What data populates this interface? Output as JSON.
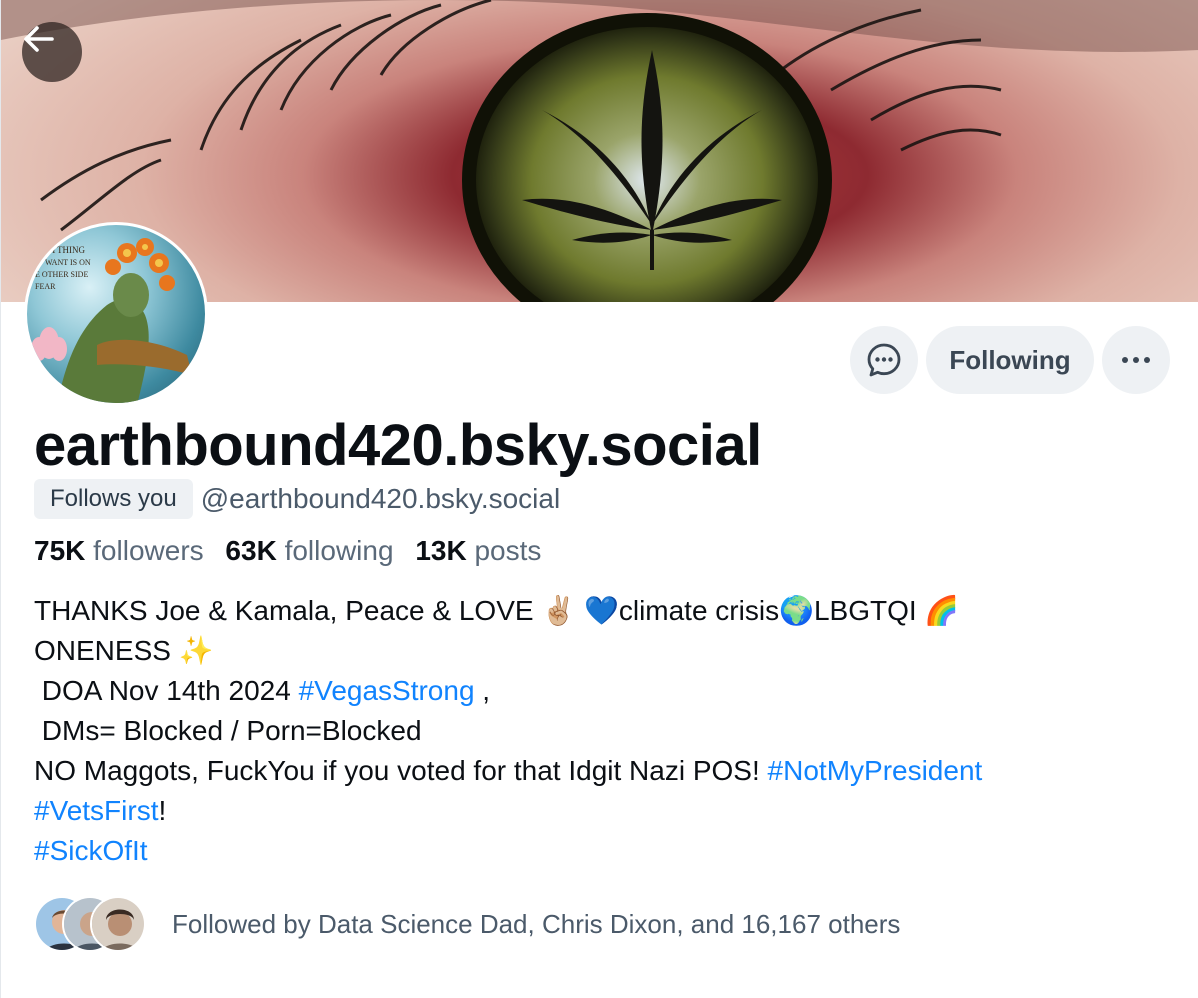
{
  "colors": {
    "accent_link": "#1083fe",
    "button_bg": "#eef1f4",
    "muted_text": "#5a6979"
  },
  "icons": {
    "back": "arrow-left-icon",
    "message": "chat-bubble-icon",
    "more": "ellipsis-icon"
  },
  "profile": {
    "display_name": "earthbound420.bsky.social",
    "follows_you": "Follows you",
    "handle": "@earthbound420.bsky.social",
    "follow_button": "Following"
  },
  "stats": {
    "followers_count": "75K",
    "followers_label": "followers",
    "following_count": "63K",
    "following_label": "following",
    "posts_count": "13K",
    "posts_label": "posts"
  },
  "bio": {
    "line1": "THANKS Joe & Kamala, Peace & LOVE ✌🏼 💙climate crisis🌍LBGTQI 🌈",
    "line2": "ONENESS ✨",
    "line3_text": " DOA Nov 14th 2024 ",
    "line3_tag": "#VegasStrong",
    "line3_suffix": " ,",
    "line4": " DMs= Blocked / Porn=Blocked",
    "line5_text": "NO Maggots, FuckYou if you voted for that Idgit Nazi POS! ",
    "line5_tag": "#NotMyPresident",
    "line6_tag": "#VetsFirst",
    "line6_suffix": "!",
    "line7_tag": "#SickOfIt"
  },
  "followed_by": {
    "text": "Followed by Data Science Dad, Chris Dixon, and 16,167 others"
  },
  "avatar_text": {
    "lines": [
      "RYTHING",
      "WANT IS ON",
      "E OTHER SIDE",
      "FEAR"
    ]
  }
}
